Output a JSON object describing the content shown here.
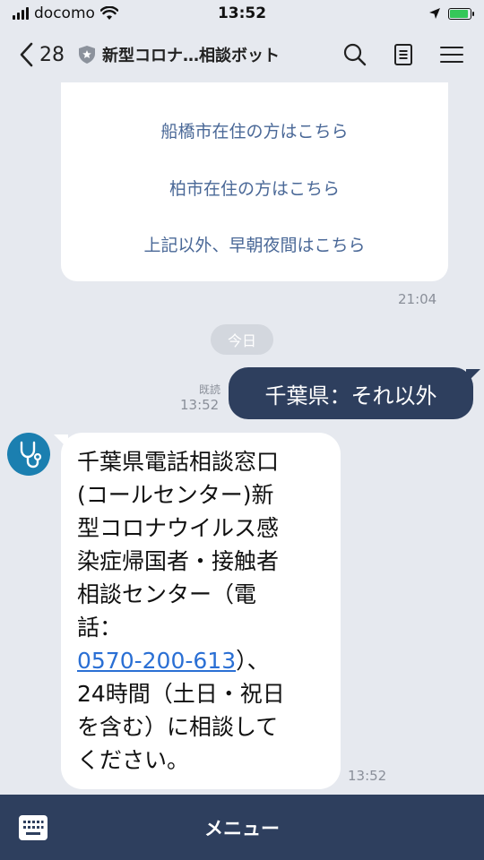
{
  "status_bar": {
    "carrier": "docomo",
    "time": "13:52",
    "battery_level": 0.9
  },
  "header": {
    "back_count": "28",
    "title": "新型コロナ…相談ボット",
    "icons": [
      "search-icon",
      "note-icon",
      "menu-icon"
    ]
  },
  "previous_message": {
    "items": [
      "船橋市在住の方はこちら",
      "柏市在住の方はこちら",
      "上記以外、早朝夜間はこちら"
    ],
    "time": "21:04"
  },
  "date_separator": "今日",
  "sent_message": {
    "read_label": "既読",
    "time": "13:52",
    "text": "千葉県：それ以外"
  },
  "received_message": {
    "lines": [
      "千葉県電話相談窓口",
      "(コールセンター)新",
      "型コロナウイルス感",
      "染症帰国者・接触者",
      "相談センター（電",
      "話：",
      "0570-200-613",
      "）、",
      "24時間（土日・祝日",
      "を含む）に相談して",
      "ください。"
    ],
    "time": "13:52"
  },
  "bottom_bar": {
    "menu_label": "メニュー"
  },
  "colors": {
    "background": "#e6e9ef",
    "dark_navy": "#2e3f5e",
    "link_blue": "#2a6fd4",
    "card_text": "#4a6897"
  }
}
